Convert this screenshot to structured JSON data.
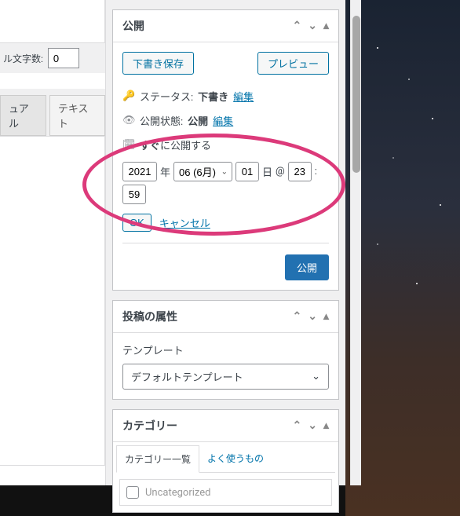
{
  "left": {
    "wordcount_label": "ル文字数:",
    "wordcount_value": "0",
    "tab_visual": "ュアル",
    "tab_text": "テキスト"
  },
  "publish": {
    "title": "公開",
    "save_draft": "下書き保存",
    "preview": "プレビュー",
    "status_label": "ステータス:",
    "status_value": "下書き",
    "status_edit": "編集",
    "visibility_label": "公開状態:",
    "visibility_value": "公開",
    "visibility_edit": "編集",
    "publish_on_prefix": "すぐ",
    "publish_on_suffix": "に公開する",
    "date_year": "2021",
    "date_year_suffix": "年",
    "date_month": "06 (6月)",
    "date_day": "01",
    "date_day_suffix": "日",
    "at_symbol": "@",
    "date_hour": "23",
    "date_sep": ":",
    "date_min": "59",
    "ok": "OK",
    "cancel": "キャンセル",
    "publish_btn": "公開"
  },
  "attributes": {
    "title": "投稿の属性",
    "template_label": "テンプレート",
    "template_value": "デフォルトテンプレート"
  },
  "categories": {
    "title": "カテゴリー",
    "tab_all": "カテゴリー一覧",
    "tab_popular": "よく使うもの",
    "item_uncategorized": "Uncategorized"
  }
}
